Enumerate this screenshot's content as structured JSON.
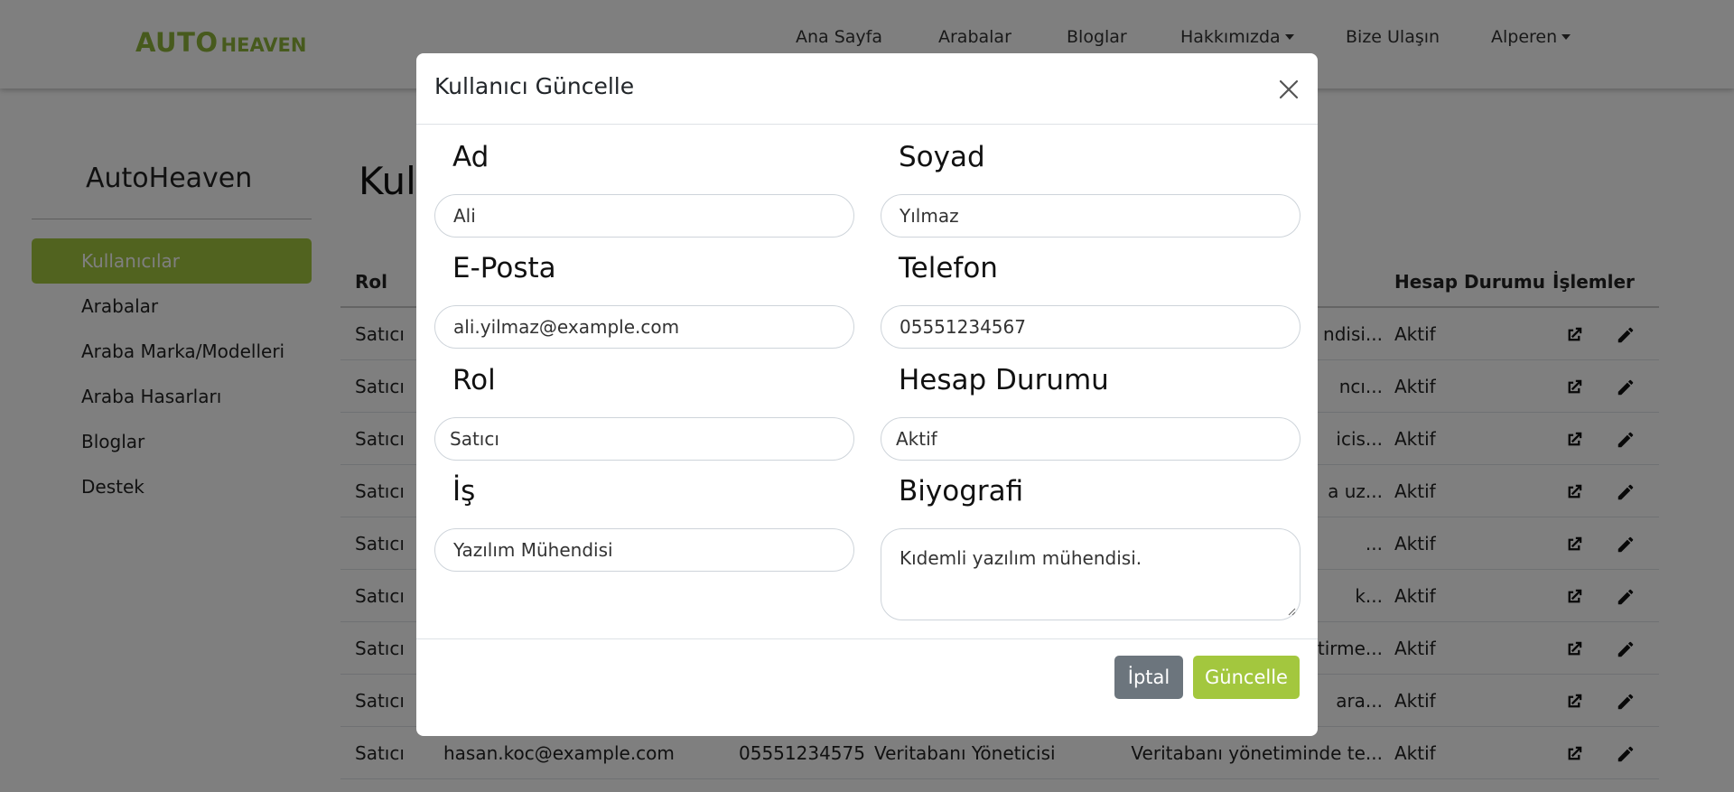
{
  "navbar": {
    "brand_main": "AUTO",
    "brand_sub": "HEAVEN",
    "links": [
      "Ana Sayfa",
      "Arabalar",
      "Bloglar",
      "Hakkımızda",
      "Bize Ulaşın",
      "Alperen"
    ]
  },
  "sidebar": {
    "title": "AutoHeaven",
    "items": [
      "Kullanıcılar",
      "Arabalar",
      "Araba Marka/Modelleri",
      "Araba Hasarları",
      "Bloglar",
      "Destek"
    ]
  },
  "page": {
    "heading": "Kull"
  },
  "table": {
    "headers": {
      "rol": "Rol",
      "status": "Hesap Durumu",
      "actions": "İşlemler"
    },
    "rows": [
      {
        "rol": "Satıcı",
        "bio": "ndisi...",
        "status": "Aktif"
      },
      {
        "rol": "Satıcı",
        "bio": "ncı...",
        "status": "Aktif"
      },
      {
        "rol": "Satıcı",
        "bio": "icis...",
        "status": "Aktif"
      },
      {
        "rol": "Satıcı",
        "bio": "a uz...",
        "status": "Aktif"
      },
      {
        "rol": "Satıcı",
        "bio": "...",
        "status": "Aktif"
      },
      {
        "rol": "Satıcı",
        "bio": "k...",
        "status": "Aktif"
      },
      {
        "rol": "Satıcı",
        "bio": "tirme...",
        "status": "Aktif"
      },
      {
        "rol": "Satıcı",
        "bio": "ara...",
        "status": "Aktif"
      },
      {
        "rol": "Satıcı",
        "email": "hasan.koc@example.com",
        "phone": "05551234575",
        "job": "Veritabanı Yöneticisi",
        "bio": "Veritabanı yönetiminde te...",
        "status": "Aktif"
      }
    ]
  },
  "modal": {
    "title": "Kullanıcı Güncelle",
    "fields": {
      "ad": {
        "label": "Ad",
        "value": "Ali"
      },
      "soyad": {
        "label": "Soyad",
        "value": "Yılmaz"
      },
      "eposta": {
        "label": "E-Posta",
        "value": "ali.yilmaz@example.com"
      },
      "telefon": {
        "label": "Telefon",
        "value": "05551234567"
      },
      "rol": {
        "label": "Rol",
        "value": "Satıcı"
      },
      "durum": {
        "label": "Hesap Durumu",
        "value": "Aktif"
      },
      "is": {
        "label": "İş",
        "value": "Yazılım Mühendisi"
      },
      "biyografi": {
        "label": "Biyografi",
        "value": "Kıdemli yazılım mühendisi."
      }
    },
    "buttons": {
      "cancel": "İptal",
      "update": "Güncelle"
    }
  },
  "colors": {
    "brand": "#8fb43a",
    "accent": "#a3c73e",
    "cancel": "#6c757d",
    "overlay": "rgba(0,0,0,0.5)"
  },
  "icons": [
    "external-link-icon",
    "pencil-icon",
    "close-icon"
  ]
}
